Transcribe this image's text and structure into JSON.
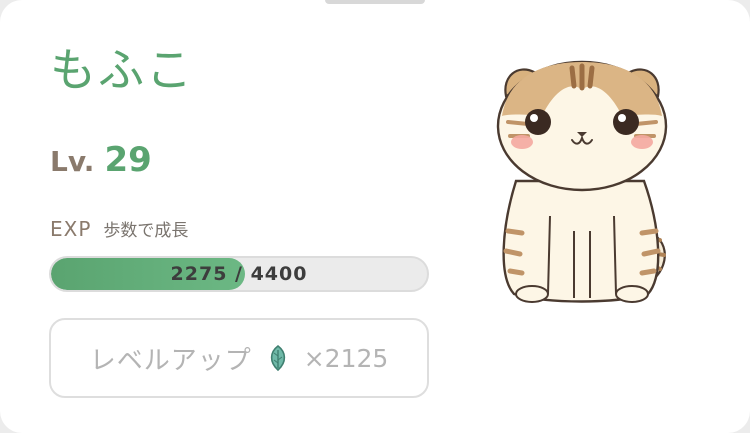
{
  "pet": {
    "name": "もふこ",
    "level_label": "Lv.",
    "level": "29"
  },
  "exp": {
    "label": "EXP",
    "subtitle": "歩数で成長",
    "current": 2275,
    "max": 4400,
    "progress_text": "2275 / 4400"
  },
  "level_up": {
    "label": "レベルアップ",
    "icon": "leaf-icon",
    "cost_text": "×2125"
  },
  "colors": {
    "accent": "#5aa470",
    "label_brown": "#8a7a6c"
  },
  "image": {
    "subject": "cat-illustration"
  }
}
